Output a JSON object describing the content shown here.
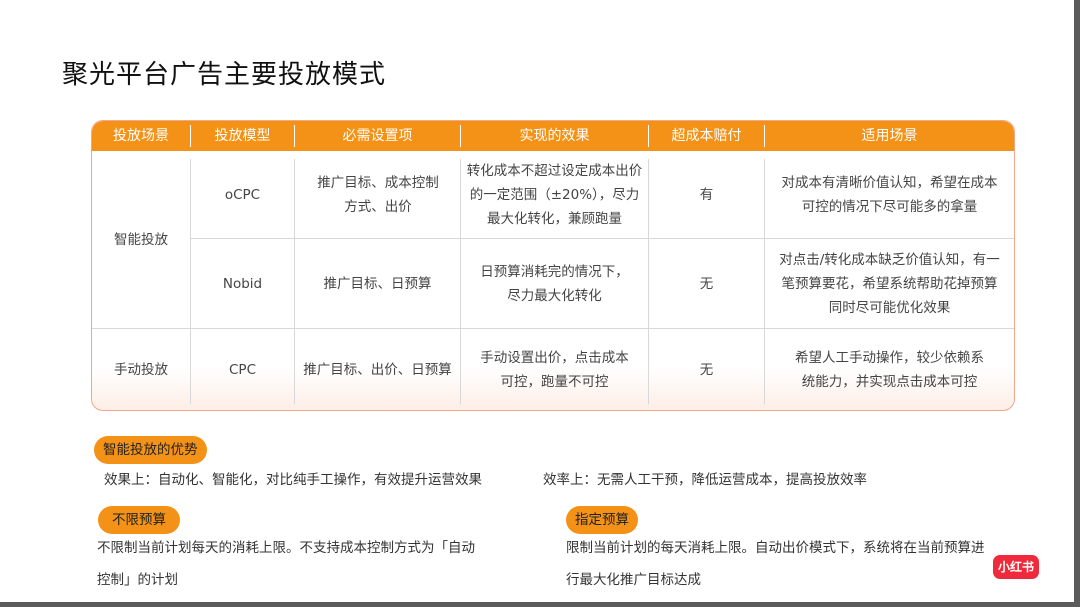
{
  "title": "聚光平台广告主要投放模式",
  "table": {
    "headers": [
      "投放场景",
      "投放模型",
      "必需设置项",
      "实现的效果",
      "超成本赔付",
      "适用场景"
    ],
    "scene_smart": "智能投放",
    "scene_manual": "手动投放",
    "rows": [
      {
        "model": "oCPC",
        "settings": "推广目标、成本控制方式、出价",
        "effect": "转化成本不超过设定成本出价的一定范围（±20%），尽力最大化转化，兼顾跑量",
        "compensation": "有",
        "scenario": "对成本有清晰价值认知，希望在成本可控的情况下尽可能多的拿量"
      },
      {
        "model": "Nobid",
        "settings": "推广目标、日预算",
        "effect": "日预算消耗完的情况下，尽力最大化转化",
        "compensation": "无",
        "scenario": "对点击/转化成本缺乏价值认知，有一笔预算要花，希望系统帮助花掉预算同时尽可能优化效果"
      },
      {
        "model": "CPC",
        "settings": "推广目标、出价、日预算",
        "effect": "手动设置出价，点击成本可控，跑量不可控",
        "compensation": "无",
        "scenario": "希望人工手动操作，较少依赖系统能力，并实现点击成本可控"
      }
    ]
  },
  "advantages": {
    "tag": "智能投放的优势",
    "effect": "效果上：自动化、智能化，对比纯手工操作，有效提升运营效果",
    "efficiency": "效率上：无需人工干预，降低运营成本，提高投放效率"
  },
  "unlimited": {
    "tag": "不限预算",
    "line1": "不限制当前计划每天的消耗上限。不支持成本控制方式为「自动",
    "line2": "控制」的计划"
  },
  "specified": {
    "tag": "指定预算",
    "line1": "限制当前计划的每天消耗上限。自动出价模式下，系统将在当前预算进",
    "line2": "行最大化推广目标达成"
  },
  "logo": "小红书",
  "colors": {
    "accent": "#f39217",
    "logo": "#ee2a3c"
  }
}
